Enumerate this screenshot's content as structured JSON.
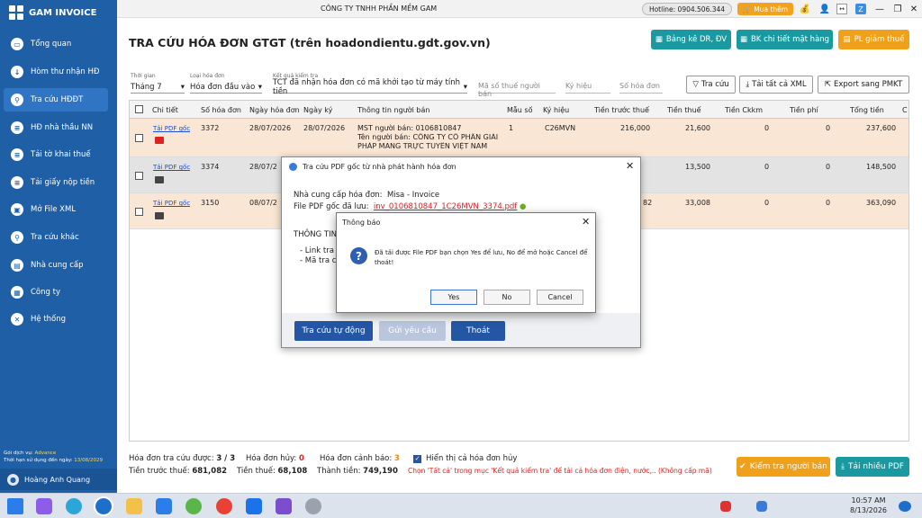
{
  "app": {
    "name": "GAM INVOICE",
    "company": "CÔNG TY TNHH PHẦN MỀM GAM",
    "hotline": "Hotline: 0904.506.344",
    "buy": "Mua thêm"
  },
  "sidebar": {
    "items": [
      {
        "label": "Tổng quan",
        "icon": "dashboard-icon"
      },
      {
        "label": "Hòm thư nhận HĐ",
        "icon": "inbox-icon"
      },
      {
        "label": "Tra cứu HĐĐT",
        "icon": "search-icon"
      },
      {
        "label": "HĐ nhà thầu NN",
        "icon": "document-icon"
      },
      {
        "label": "Tải tờ khai thuế",
        "icon": "tax-icon"
      },
      {
        "label": "Tải giấy nộp tiền",
        "icon": "payment-icon"
      },
      {
        "label": "Mở File XML",
        "icon": "folder-icon"
      },
      {
        "label": "Tra cứu khác",
        "icon": "lookup-icon"
      },
      {
        "label": "Nhà cung cấp",
        "icon": "vendor-icon"
      },
      {
        "label": "Công ty",
        "icon": "company-icon"
      },
      {
        "label": "Hệ thống",
        "icon": "settings-icon"
      }
    ],
    "service_label": "Gói dịch vụ:",
    "service_value": "Advance",
    "expiry_label": "Thời hạn sử dụng đến ngày:",
    "expiry_value": "13/08/2029",
    "user": "Hoàng Anh Quang"
  },
  "header": {
    "title": "TRA CỨU HÓA ĐƠN GTGT (trên hoadondientu.gdt.gov.vn)",
    "btn_dr": "Bảng kê DR, ĐV",
    "btn_bk": "BK chi tiết mặt hàng",
    "btn_pl": "PL giảm thuế"
  },
  "filters": {
    "period_label": "Thời gian",
    "period_value": "Tháng 7",
    "type_label": "Loại hóa đơn",
    "type_value": "Hóa đơn đầu vào",
    "result_label": "Kết quả kiểm tra",
    "result_value": "TCT đã nhận hóa đơn có mã khởi tạo từ máy tính tiền",
    "mst_ph": "Mã số thuế người bán",
    "kh_ph": "Ký hiệu",
    "so_ph": "Số hóa đơn",
    "btn_search": "Tra cứu",
    "btn_xml": "Tải tất cả XML",
    "btn_export": "Export sang PMKT"
  },
  "table": {
    "headers": [
      "Chi tiết",
      "Số hóa đơn",
      "Ngày hóa đơn",
      "Ngày ký",
      "Thông tin người bán",
      "Mẫu số",
      "Ký hiệu",
      "Tiền trước thuế",
      "Tiền thuế",
      "Tiền Ckkm",
      "Tiền phí",
      "Tổng tiền",
      "C"
    ],
    "rows": [
      {
        "link": "Tải PDF gốc",
        "so": "3372",
        "ngay": "28/07/2026",
        "ky": "28/07/2026",
        "seller1": "MST người bán: 0106810847",
        "seller2": "Tên người bán: CÔNG TY CỔ PHẦN GIẢI",
        "seller3": "PHÁP MANG TRỰC TUYẾN VIỆT NAM",
        "mau": "1",
        "kh": "C26MVN",
        "truoc": "216,000",
        "thue": "21,600",
        "ck": "0",
        "phi": "0",
        "tong": "237,600"
      },
      {
        "link": "Tải PDF gốc",
        "so": "3374",
        "ngay": "28/07/2",
        "thue": "13,500",
        "ck": "0",
        "phi": "0",
        "tong": "148,500"
      },
      {
        "link": "Tải PDF gốc",
        "so": "3150",
        "ngay": "08/07/2",
        "truoc": "82",
        "thue": "33,008",
        "ck": "0",
        "phi": "0",
        "tong": "363,090"
      }
    ]
  },
  "footer": {
    "found_label": "Hóa đơn tra cứu được:",
    "found": "3 / 3",
    "cancel_label": "Hóa đơn hủy:",
    "cancel": "0",
    "warn_label": "Hóa đơn cảnh báo:",
    "warn": "3",
    "show_cancel": "Hiển thị cả hóa đơn hủy",
    "pre_label": "Tiền trước thuế:",
    "pre": "681,082",
    "tax_label": "Tiền thuế:",
    "tax": "68,108",
    "total_label": "Thành tiền:",
    "total": "749,190",
    "note": "Chọn 'Tất cả' trong mục 'Kết quả kiểm tra' để tải cả hóa đơn điện, nước,.. (Không cấp mã)",
    "btn_check": "Kiểm tra người bán",
    "btn_pdf": "Tải nhiều PDF"
  },
  "dialog_pdf": {
    "title": "Tra cứu PDF gốc từ nhà phát hành hóa đơn",
    "provider_label": "Nhà cung cấp hóa đơn:",
    "provider": "Misa - Invoice",
    "file_label": "File PDF gốc đã lưu:",
    "file": "inv_0106810847_1C26MVN_3374.pdf",
    "info": "THÔNG TIN T",
    "link1": "- Link tra cứ",
    "link2": "- Mã tra cứ",
    "btn_auto": "Tra cứu tự động",
    "btn_send": "Gửi yêu cầu",
    "btn_exit": "Thoát"
  },
  "dialog_msg": {
    "title": "Thông báo",
    "text1": "Đã tải được File PDF bạn chọn Yes để lưu, No để mở hoặc Cancel để",
    "text2": "thoát!",
    "yes": "Yes",
    "no": "No",
    "cancel": "Cancel"
  },
  "taskbar": {
    "time": "10:57 AM",
    "date": "8/13/2026"
  },
  "colors": {
    "sidebar": "#1f5fa6",
    "teal": "#1a9aa0",
    "orange": "#f0a11b",
    "dialog_btn": "#2456a4"
  }
}
